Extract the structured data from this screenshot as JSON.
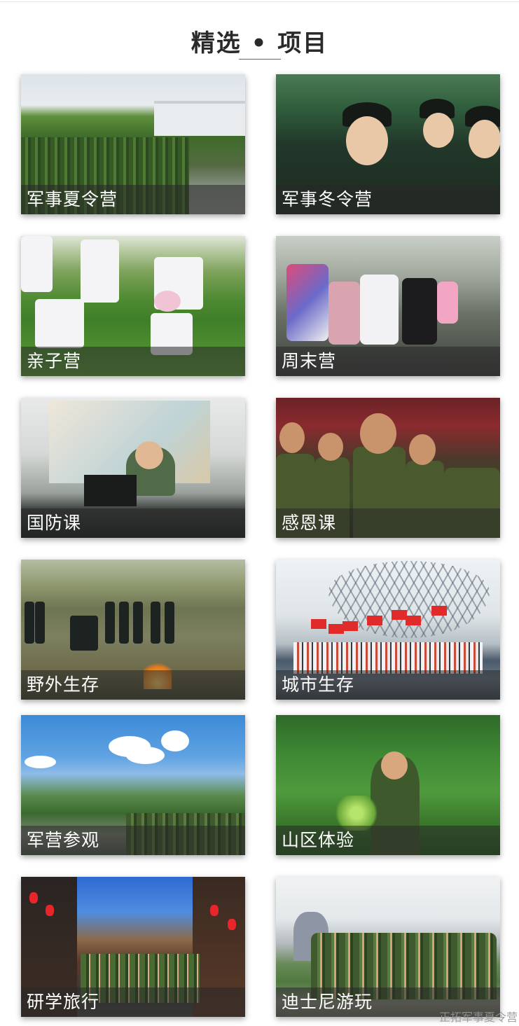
{
  "section": {
    "title": "精选 • 项目"
  },
  "projects": [
    {
      "label": "军事夏令营"
    },
    {
      "label": "军事冬令营"
    },
    {
      "label": "亲子营"
    },
    {
      "label": "周末营"
    },
    {
      "label": "国防课"
    },
    {
      "label": "感恩课"
    },
    {
      "label": "野外生存"
    },
    {
      "label": "城市生存"
    },
    {
      "label": "军营参观"
    },
    {
      "label": "山区体验"
    },
    {
      "label": "研学旅行"
    },
    {
      "label": "迪士尼游玩"
    }
  ],
  "watermark": "正拓军事夏令营"
}
